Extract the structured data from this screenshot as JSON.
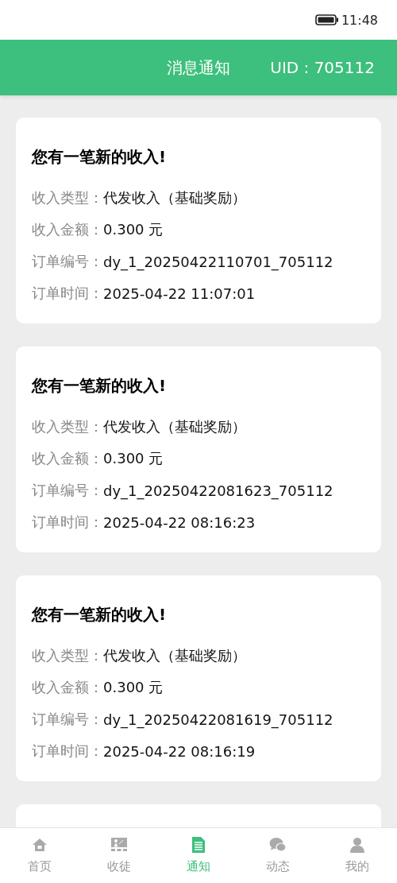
{
  "status_bar": {
    "time": "11:48"
  },
  "header": {
    "title": "消息通知",
    "uid": "UID : 705112"
  },
  "notifications": [
    {
      "title": "您有一笔新的收入!",
      "fields": [
        {
          "label": "收入类型：",
          "value": "代发收入（基础奖励）"
        },
        {
          "label": "收入金额：",
          "value": "0.300 元"
        },
        {
          "label": "订单编号：",
          "value": "dy_1_20250422110701_705112"
        },
        {
          "label": "订单时间：",
          "value": "2025-04-22 11:07:01"
        }
      ]
    },
    {
      "title": "您有一笔新的收入!",
      "fields": [
        {
          "label": "收入类型：",
          "value": "代发收入（基础奖励）"
        },
        {
          "label": "收入金额：",
          "value": "0.300 元"
        },
        {
          "label": "订单编号：",
          "value": "dy_1_20250422081623_705112"
        },
        {
          "label": "订单时间：",
          "value": "2025-04-22 08:16:23"
        }
      ]
    },
    {
      "title": "您有一笔新的收入!",
      "fields": [
        {
          "label": "收入类型：",
          "value": "代发收入（基础奖励）"
        },
        {
          "label": "收入金额：",
          "value": "0.300 元"
        },
        {
          "label": "订单编号：",
          "value": "dy_1_20250422081619_705112"
        },
        {
          "label": "订单时间：",
          "value": "2025-04-22 08:16:19"
        }
      ]
    }
  ],
  "tab_bar": [
    {
      "kind": "home",
      "label": "首页",
      "selected": false
    },
    {
      "kind": "recruit",
      "label": "收徒",
      "selected": false
    },
    {
      "kind": "notice",
      "label": "通知",
      "selected": true
    },
    {
      "kind": "feed",
      "label": "动态",
      "selected": false
    },
    {
      "kind": "profile",
      "label": "我的",
      "selected": false
    }
  ]
}
